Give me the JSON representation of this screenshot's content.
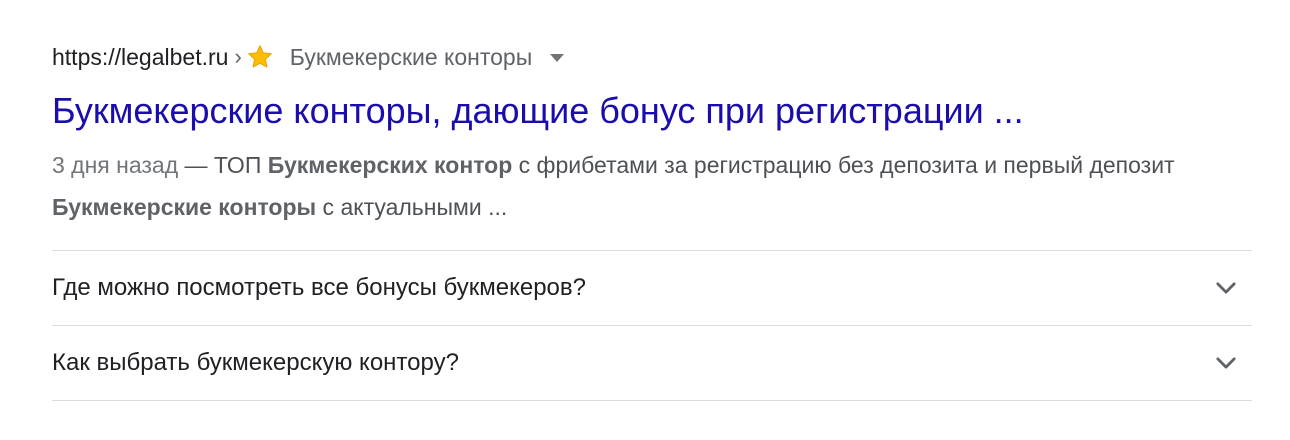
{
  "result": {
    "domain": "https://legalbet.ru",
    "separator": "›",
    "path": "Букмекерские конторы",
    "title": "Букмекерские конторы, дающие бонус при регистрации ...",
    "snippet": {
      "date": "3 дня назад",
      "dash": " — ТОП ",
      "bold1": "Букмекерских контор",
      "text1": " с фрибетами за регистрацию без депозита и первый депозит ",
      "bold2": "Букмекерские конторы",
      "text2": " с актуальными ..."
    }
  },
  "faq": [
    {
      "question": "Где можно посмотреть все бонусы букмекеров?"
    },
    {
      "question": "Как выбрать букмекерскую контору?"
    }
  ],
  "icons": {
    "star": "star-icon",
    "caret": "caret-down-icon",
    "chevron": "chevron-down-icon"
  },
  "colors": {
    "title_link": "#1a0dab",
    "star": "#fbbc04"
  }
}
